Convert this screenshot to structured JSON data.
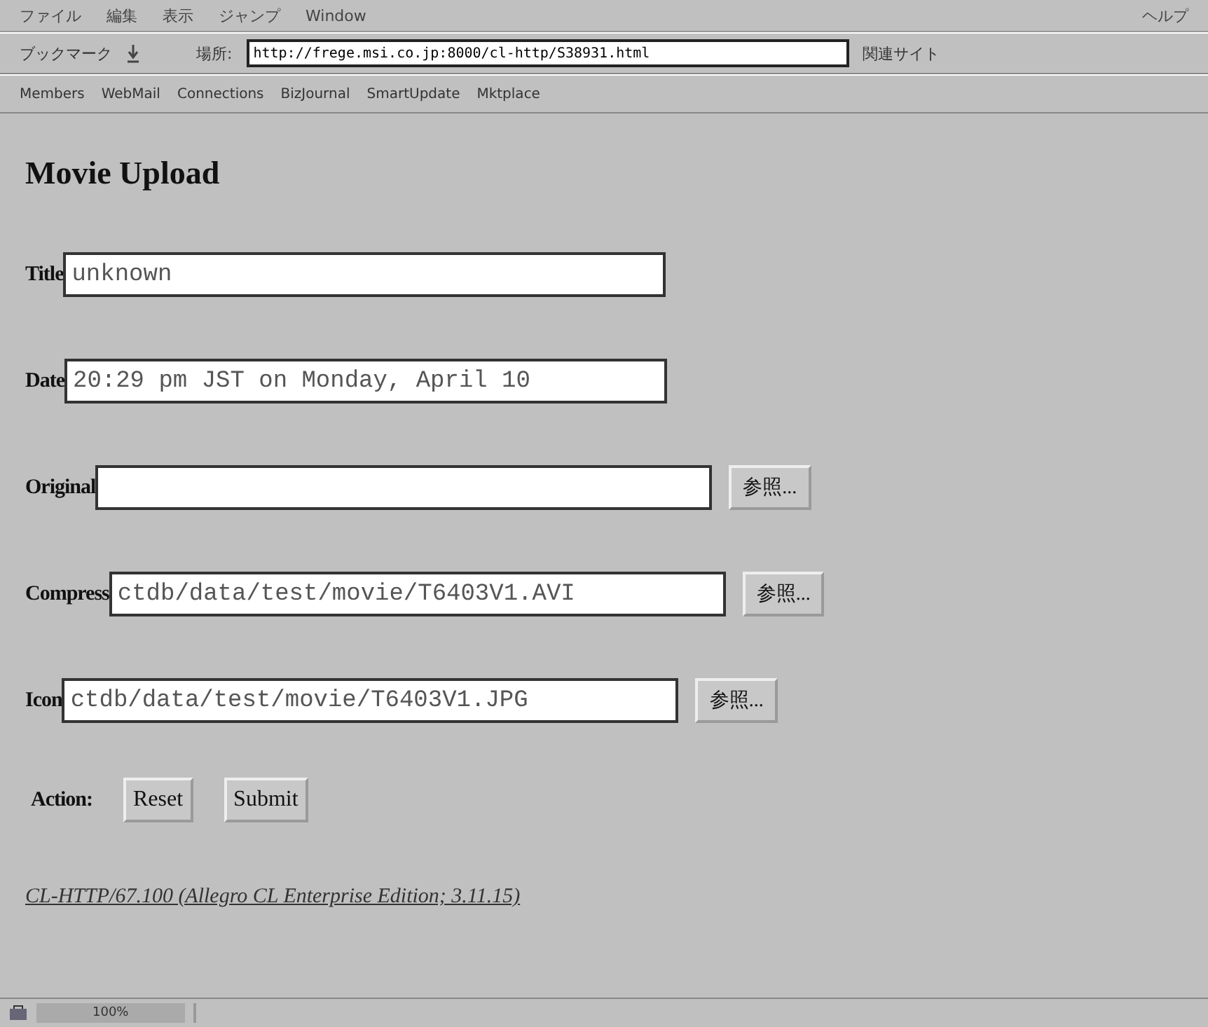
{
  "menu": [
    "ファイル",
    "編集",
    "表示",
    "ジャンプ",
    "Window"
  ],
  "help_menu": "ヘルプ",
  "location_bar": {
    "bookmarks": "ブックマーク",
    "label": "場所:",
    "url": "http://frege.msi.co.jp:8000/cl-http/S38931.html",
    "related": "関連サイト"
  },
  "personal_toolbar": [
    "Members",
    "WebMail",
    "Connections",
    "BizJournal",
    "SmartUpdate",
    "Mktplace"
  ],
  "heading": "Movie Upload",
  "fields": [
    {
      "label": "Title",
      "kind": "text",
      "value": "unknown"
    },
    {
      "label": "Date",
      "kind": "text",
      "value": "20:29 pm JST on Monday, April 10"
    },
    {
      "label": "Original",
      "kind": "file",
      "browse": "参照..."
    },
    {
      "label": "Compress",
      "kind": "file",
      "value": "ctdb/data/test/movie/T6403V1.AVI",
      "browse": "参照..."
    },
    {
      "label": "Icon",
      "kind": "file",
      "value": "ctdb/data/test/movie/T6403V1.JPG",
      "browse": "参照..."
    }
  ],
  "action": {
    "label": "Action:",
    "buttons": [
      "Reset",
      "Submit"
    ]
  },
  "footer_link": "CL-HTTP/67.100 (Allegro CL Enterprise Edition; 3.11.15)",
  "status_bar": {
    "progress": "100%"
  }
}
